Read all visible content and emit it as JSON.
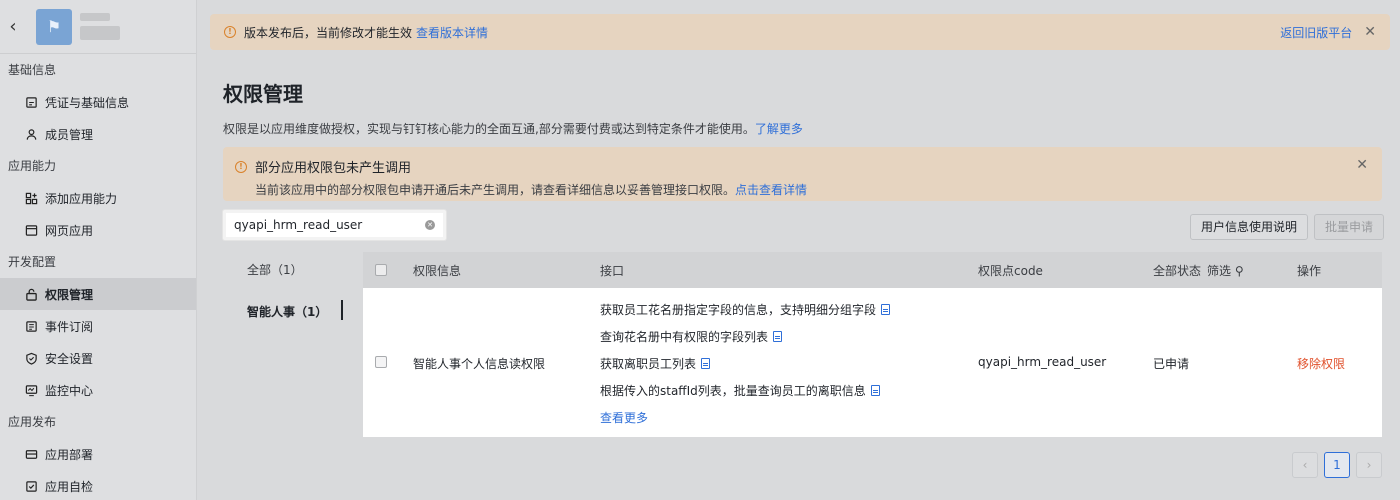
{
  "sidebar": {
    "back_icon": "chevron-left-icon",
    "groups": [
      {
        "title": "基础信息",
        "items": [
          {
            "label": "凭证与基础信息",
            "icon": "credential-icon"
          },
          {
            "label": "成员管理",
            "icon": "user-icon"
          }
        ]
      },
      {
        "title": "应用能力",
        "items": [
          {
            "label": "添加应用能力",
            "icon": "apps-add-icon"
          },
          {
            "label": "网页应用",
            "icon": "webpage-icon"
          }
        ]
      },
      {
        "title": "开发配置",
        "items": [
          {
            "label": "权限管理",
            "icon": "lock-icon",
            "active": true
          },
          {
            "label": "事件订阅",
            "icon": "event-icon"
          },
          {
            "label": "安全设置",
            "icon": "shield-icon"
          },
          {
            "label": "监控中心",
            "icon": "monitor-icon"
          }
        ]
      },
      {
        "title": "应用发布",
        "items": [
          {
            "label": "应用部署",
            "icon": "deploy-icon"
          },
          {
            "label": "应用自检",
            "icon": "check-icon"
          }
        ]
      }
    ]
  },
  "release_bar": {
    "text": "版本发布后，当前修改才能生效",
    "link": "查看版本详情",
    "right_link": "返回旧版平台"
  },
  "page": {
    "title": "权限管理",
    "desc": "权限是以应用维度做授权，实现与钉钉核心能力的全面互通,部分需要付费或达到特定条件才能使用。",
    "desc_link": "了解更多"
  },
  "notice": {
    "title": "部分应用权限包未产生调用",
    "text": "当前该应用中的部分权限包申请开通后未产生调用，请查看详细信息以妥善管理接口权限。",
    "link": "点击查看详情"
  },
  "search": {
    "value": "qyapi_hrm_read_user"
  },
  "buttons": {
    "usage": "用户信息使用说明",
    "batch": "批量申请"
  },
  "categories": {
    "all": "全部（1）",
    "hr": "智能人事（1）"
  },
  "table": {
    "headers": {
      "info": "权限信息",
      "api": "接口",
      "code": "权限点code",
      "status": "全部状态",
      "filter": "筛选",
      "action": "操作"
    },
    "rows": [
      {
        "info": "智能人事个人信息读权限",
        "apis": [
          "获取员工花名册指定字段的信息，支持明细分组字段",
          "查询花名册中有权限的字段列表",
          "获取离职员工列表",
          "根据传入的staffId列表，批量查询员工的离职信息"
        ],
        "more": "查看更多",
        "code": "qyapi_hrm_read_user",
        "status": "已申请",
        "action": "移除权限"
      }
    ]
  },
  "pagination": {
    "current": "1",
    "prev": "‹",
    "next": "›"
  },
  "colors": {
    "accent": "#2f6fd8",
    "danger": "#e0502b",
    "warning": "#d9822b"
  }
}
